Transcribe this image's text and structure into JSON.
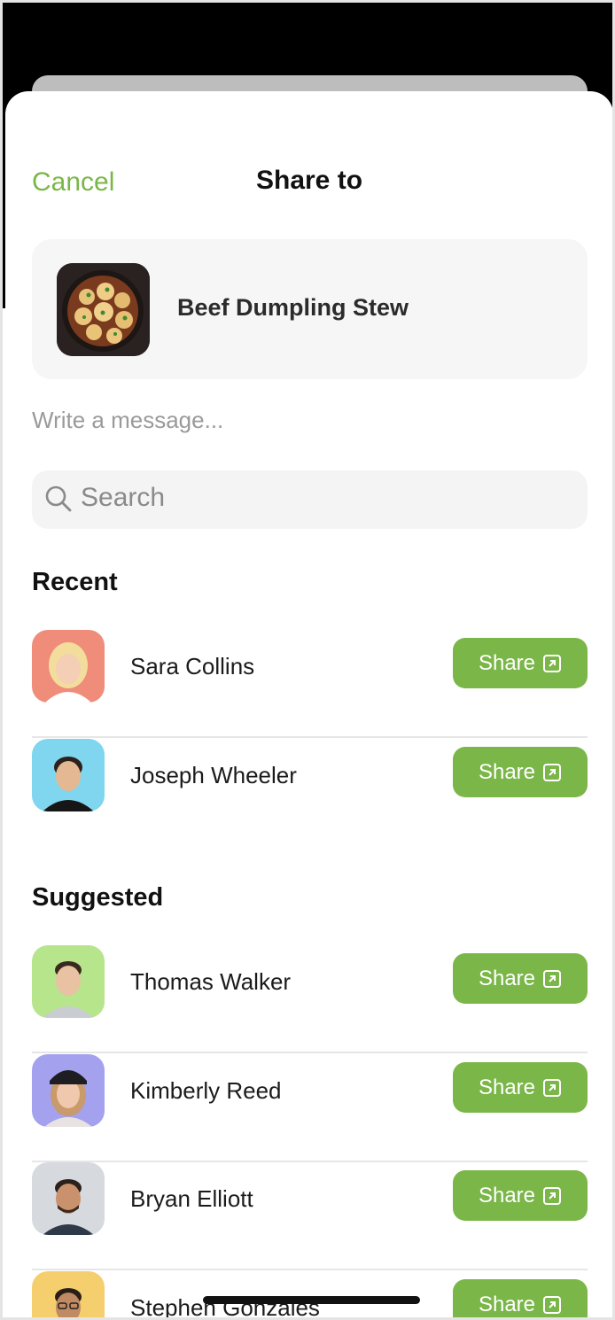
{
  "header": {
    "cancel_label": "Cancel",
    "title": "Share to"
  },
  "recipe": {
    "name": "Beef Dumpling Stew",
    "image": "stew-photo"
  },
  "message": {
    "placeholder": "Write a message..."
  },
  "search": {
    "placeholder": "Search",
    "icon": "search-icon"
  },
  "recent": {
    "title": "Recent",
    "people": [
      {
        "name": "Sara Collins",
        "share_label": "Share",
        "avatar_bg": "#ef8d7a"
      },
      {
        "name": "Joseph Wheeler",
        "share_label": "Share",
        "avatar_bg": "#7fd6ee"
      }
    ]
  },
  "suggested": {
    "title": "Suggested",
    "people": [
      {
        "name": "Thomas Walker",
        "share_label": "Share",
        "avatar_bg": "#b6e58c"
      },
      {
        "name": "Kimberly Reed",
        "share_label": "Share",
        "avatar_bg": "#a4a1ee"
      },
      {
        "name": "Bryan Elliott",
        "share_label": "Share",
        "avatar_bg": "#d6d9de"
      },
      {
        "name": "Stephen Gonzales",
        "share_label": "Share",
        "avatar_bg": "#f5cf6e"
      }
    ]
  },
  "colors": {
    "accent": "#7ab648",
    "backdrop": "#000000"
  }
}
